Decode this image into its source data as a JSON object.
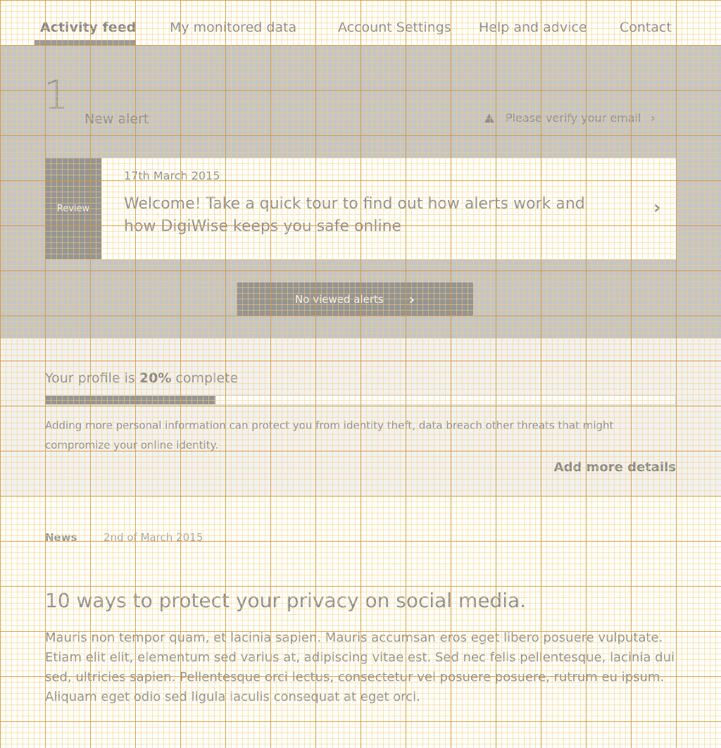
{
  "nav": {
    "items": [
      {
        "label": "Activity feed"
      },
      {
        "label": "My monitored data"
      },
      {
        "label": "Account Settings"
      },
      {
        "label": "Help and advice"
      },
      {
        "label": "Contact"
      }
    ]
  },
  "alerts": {
    "count": "1",
    "count_label": "New alert",
    "verify_text": "Please verify your email"
  },
  "alert_card": {
    "badge": "Review",
    "date": "17th March 2015",
    "title": "Welcome! Take a quick tour to find out how alerts work and how DigiWise keeps you safe online"
  },
  "viewed_button": {
    "label": "No viewed alerts"
  },
  "profile": {
    "prefix": "Your profile is ",
    "percent": "20%",
    "suffix": " complete",
    "progress_fraction": 0.27,
    "description": "Adding more personal information can protect you from identity theft, data breach other threats that might compromize your online identity.",
    "add_details": "Add more details"
  },
  "news": {
    "tag": "News",
    "date": "2nd of March 2015",
    "title": "10 ways to protect your privacy on social media.",
    "body": "Mauris non tempor quam, et lacinia sapien. Mauris accumsan eros eget libero posuere vulputate. Etiam elit elit, elementum sed varius at, adipiscing vitae est. Sed nec felis pellentesque, lacinia dui sed, ultricies sapien. Pellentesque orci lectus, consectetur vel posuere posuere, rutrum eu ipsum. Aliquam eget odio sed ligula iaculis consequat at eget orci."
  }
}
